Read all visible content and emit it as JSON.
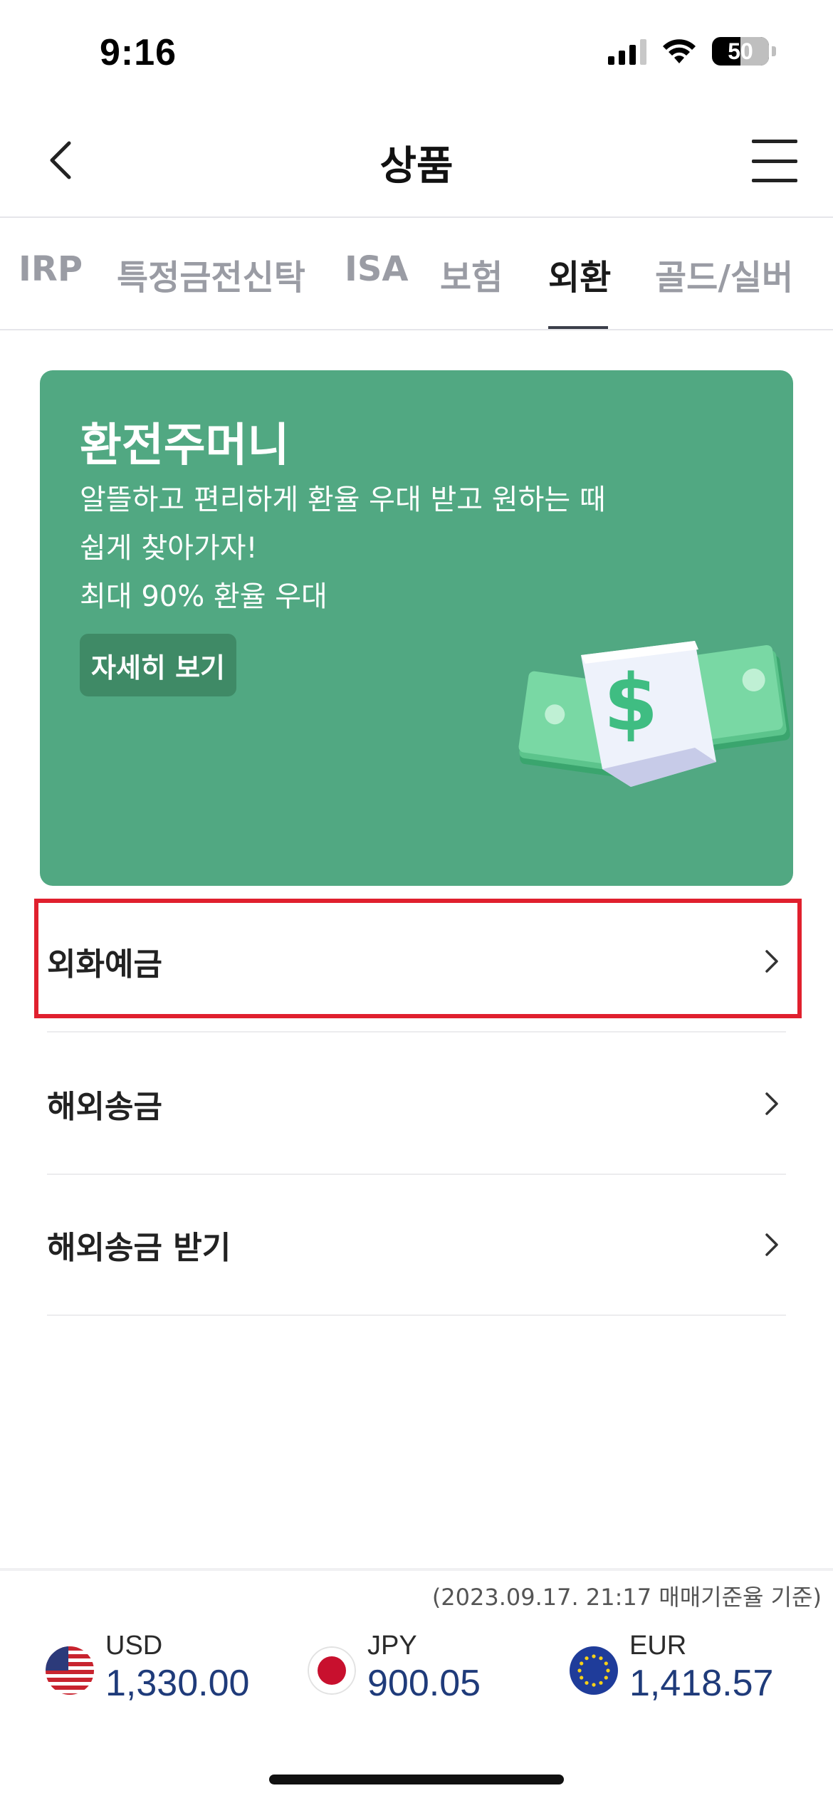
{
  "status_bar": {
    "time": "9:16",
    "battery": "50"
  },
  "header": {
    "title": "상품"
  },
  "tabs": [
    {
      "label": "IRP"
    },
    {
      "label": "특정금전신탁"
    },
    {
      "label": "ISA"
    },
    {
      "label": "보험"
    },
    {
      "label": "외환"
    },
    {
      "label": "골드/실버"
    }
  ],
  "active_tab": "외환",
  "banner": {
    "title": "환전주머니",
    "desc_line1": "알뜰하고 편리하게 환율 우대 받고 원하는 때",
    "desc_line2": "쉽게 찾아가자!",
    "desc_line3": "최대 90% 환율 우대",
    "button": "자세히 보기",
    "color": "#51a882"
  },
  "menu": [
    {
      "label": "외화예금"
    },
    {
      "label": "해외송금"
    },
    {
      "label": "해외송금 받기"
    }
  ],
  "highlight_color": "#e0202e",
  "rates": {
    "date_note": "(2023.09.17. 21:17 매매기준율 기준)",
    "items": [
      {
        "code": "USD",
        "value": "1,330.00"
      },
      {
        "code": "JPY",
        "value": "900.05"
      },
      {
        "code": "EUR",
        "value": "1,418.57"
      }
    ]
  }
}
